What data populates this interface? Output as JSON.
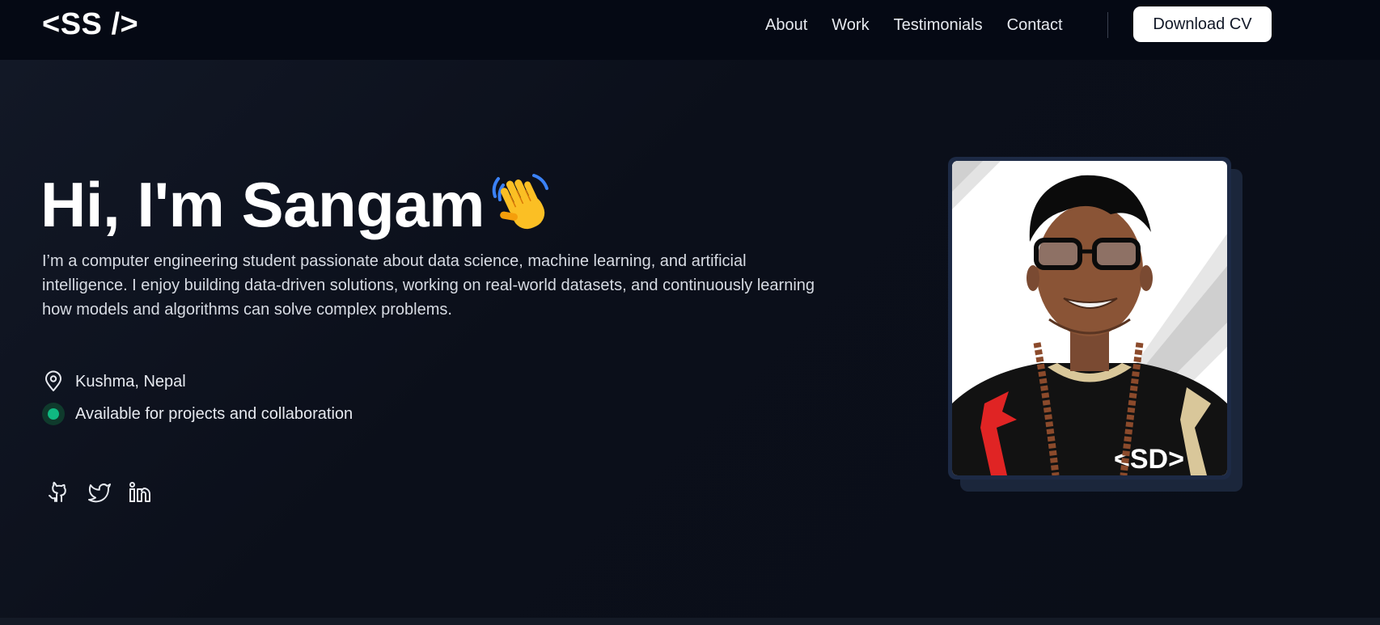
{
  "header": {
    "logo": "<SS />",
    "nav": [
      "About",
      "Work",
      "Testimonials",
      "Contact"
    ],
    "cv_button": "Download CV"
  },
  "hero": {
    "headline": "Hi, I'm Sangam",
    "wave_icon": "waving-hand-emoji",
    "intro": "I’m a computer engineering student passionate about data science, machine learning, and artificial intelligence. I enjoy building data-driven solutions, working on real-world datasets, and continuously learning how models and algorithms can solve complex problems.",
    "location": "Kushma, Nepal",
    "location_icon": "map-pin-icon",
    "status": "Available for projects and collaboration",
    "status_color": "#10b981",
    "socials": [
      "github-icon",
      "twitter-icon",
      "linkedin-icon"
    ]
  },
  "colors": {
    "header_bg": "#050914",
    "page_bg": "#0b0f1a",
    "frame": "#1d2a45",
    "button_bg": "#ffffff"
  }
}
